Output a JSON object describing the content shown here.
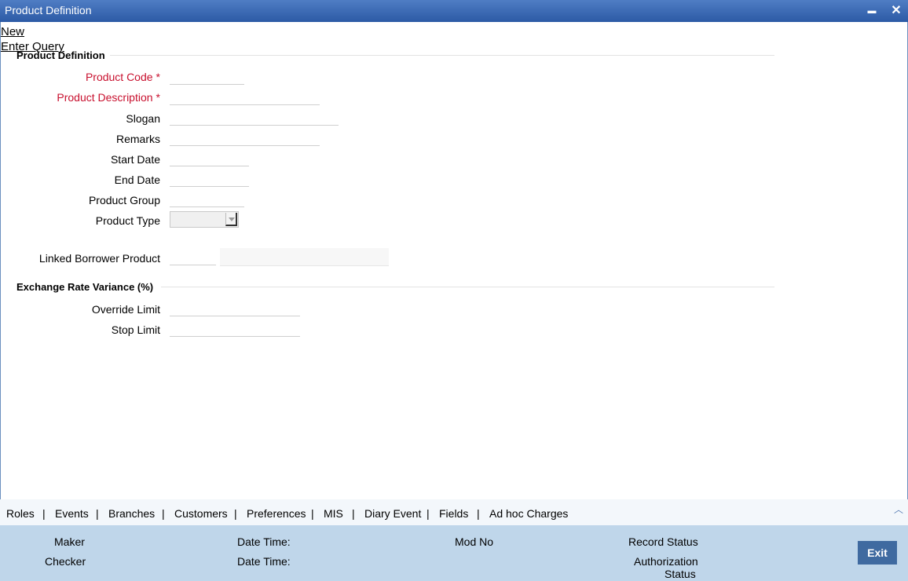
{
  "window": {
    "title": "Product Definition",
    "minimize_glyph": "▬",
    "close_glyph": "✕"
  },
  "menu": {
    "new": "New",
    "enter_query": "Enter Query"
  },
  "sections": {
    "product_definition": "Product Definition",
    "exchange_rate_variance": "Exchange Rate Variance (%)"
  },
  "fields": {
    "product_code": {
      "label": "Product Code",
      "value": ""
    },
    "product_description": {
      "label": "Product Description",
      "value": ""
    },
    "slogan": {
      "label": "Slogan",
      "value": ""
    },
    "remarks": {
      "label": "Remarks",
      "value": ""
    },
    "start_date": {
      "label": "Start Date",
      "value": ""
    },
    "end_date": {
      "label": "End Date",
      "value": ""
    },
    "product_group": {
      "label": "Product Group",
      "value": ""
    },
    "product_type": {
      "label": "Product Type",
      "value": ""
    },
    "linked_borrower_product": {
      "label": "Linked Borrower Product",
      "value": "",
      "description": ""
    },
    "override_limit": {
      "label": "Override Limit",
      "value": ""
    },
    "stop_limit": {
      "label": "Stop Limit",
      "value": ""
    }
  },
  "required_mark": "*",
  "tabs": [
    "Roles",
    "Events",
    "Branches",
    "Customers",
    "Preferences",
    "MIS",
    "Diary Event",
    "Fields",
    "Ad hoc Charges"
  ],
  "tab_separator": "|",
  "footer": {
    "maker": "Maker",
    "checker": "Checker",
    "date_time_1": "Date Time:",
    "date_time_2": "Date Time:",
    "mod_no": "Mod No",
    "record_status": "Record Status",
    "authorization_status_1": "Authorization",
    "authorization_status_2": "Status",
    "exit": "Exit"
  },
  "colors": {
    "title_bar": "#2c5aa5",
    "required": "#c8102e",
    "footer_bg": "#bfd6ea",
    "exit_button": "#3f6aa0"
  }
}
